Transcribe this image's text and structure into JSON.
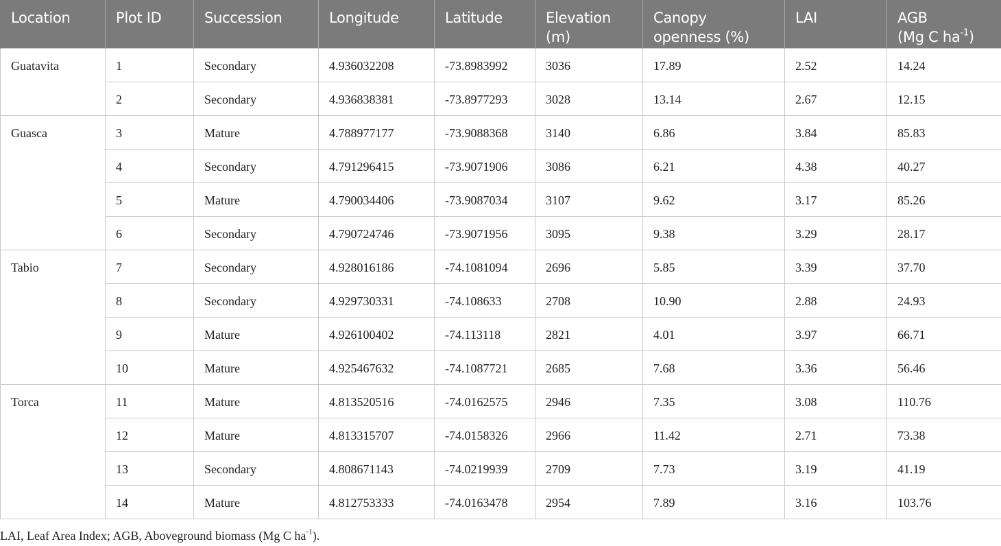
{
  "table": {
    "headers": [
      {
        "line1": "Location",
        "line2": ""
      },
      {
        "line1": "Plot ID",
        "line2": ""
      },
      {
        "line1": "Succession",
        "line2": ""
      },
      {
        "line1": "Longitude",
        "line2": ""
      },
      {
        "line1": "Latitude",
        "line2": ""
      },
      {
        "line1": "Elevation",
        "line2": "(m)"
      },
      {
        "line1": "Canopy",
        "line2": "openness (%)"
      },
      {
        "line1": "LAI",
        "line2": ""
      },
      {
        "line1": "AGB",
        "line2": "(Mg C ha",
        "sup": "-1",
        "after": ")"
      }
    ],
    "groups": [
      {
        "location": "Guatavita",
        "rows": [
          {
            "plot": "1",
            "succession": "Secondary",
            "longitude": "4.936032208",
            "latitude": "-73.8983992",
            "elevation": "3036",
            "canopy": "17.89",
            "lai": "2.52",
            "agb": "14.24"
          },
          {
            "plot": "2",
            "succession": "Secondary",
            "longitude": "4.936838381",
            "latitude": "-73.8977293",
            "elevation": "3028",
            "canopy": "13.14",
            "lai": "2.67",
            "agb": "12.15"
          }
        ]
      },
      {
        "location": "Guasca",
        "rows": [
          {
            "plot": "3",
            "succession": "Mature",
            "longitude": "4.788977177",
            "latitude": "-73.9088368",
            "elevation": "3140",
            "canopy": "6.86",
            "lai": "3.84",
            "agb": "85.83"
          },
          {
            "plot": "4",
            "succession": "Secondary",
            "longitude": "4.791296415",
            "latitude": "-73.9071906",
            "elevation": "3086",
            "canopy": "6.21",
            "lai": "4.38",
            "agb": "40.27"
          },
          {
            "plot": "5",
            "succession": "Mature",
            "longitude": "4.790034406",
            "latitude": "-73.9087034",
            "elevation": "3107",
            "canopy": "9.62",
            "lai": "3.17",
            "agb": "85.26"
          },
          {
            "plot": "6",
            "succession": "Secondary",
            "longitude": "4.790724746",
            "latitude": "-73.9071956",
            "elevation": "3095",
            "canopy": "9.38",
            "lai": "3.29",
            "agb": "28.17"
          }
        ]
      },
      {
        "location": "Tabio",
        "rows": [
          {
            "plot": "7",
            "succession": "Secondary",
            "longitude": "4.928016186",
            "latitude": "-74.1081094",
            "elevation": "2696",
            "canopy": "5.85",
            "lai": "3.39",
            "agb": "37.70"
          },
          {
            "plot": "8",
            "succession": "Secondary",
            "longitude": "4.929730331",
            "latitude": "-74.108633",
            "elevation": "2708",
            "canopy": "10.90",
            "lai": "2.88",
            "agb": "24.93"
          },
          {
            "plot": "9",
            "succession": "Mature",
            "longitude": "4.926100402",
            "latitude": "-74.113118",
            "elevation": "2821",
            "canopy": "4.01",
            "lai": "3.97",
            "agb": "66.71"
          },
          {
            "plot": "10",
            "succession": "Mature",
            "longitude": "4.925467632",
            "latitude": "-74.1087721",
            "elevation": "2685",
            "canopy": "7.68",
            "lai": "3.36",
            "agb": "56.46"
          }
        ]
      },
      {
        "location": "Torca",
        "rows": [
          {
            "plot": "11",
            "succession": "Mature",
            "longitude": "4.813520516",
            "latitude": "-74.0162575",
            "elevation": "2946",
            "canopy": "7.35",
            "lai": "3.08",
            "agb": "110.76"
          },
          {
            "plot": "12",
            "succession": "Mature",
            "longitude": "4.813315707",
            "latitude": "-74.0158326",
            "elevation": "2966",
            "canopy": "11.42",
            "lai": "2.71",
            "agb": "73.38"
          },
          {
            "plot": "13",
            "succession": "Secondary",
            "longitude": "4.808671143",
            "latitude": "-74.0219939",
            "elevation": "2709",
            "canopy": "7.73",
            "lai": "3.19",
            "agb": "41.19"
          },
          {
            "plot": "14",
            "succession": "Mature",
            "longitude": "4.812753333",
            "latitude": "-74.0163478",
            "elevation": "2954",
            "canopy": "7.89",
            "lai": "3.16",
            "agb": "103.76"
          }
        ]
      }
    ]
  },
  "footnote": {
    "text": "LAI, Leaf Area Index; AGB, Aboveground biomass (Mg C ha",
    "sup": "-1",
    "after": ")."
  },
  "colors": {
    "header_bg": "#7b7b7b",
    "header_text": "#ffffff",
    "grid": "#c9c9c9"
  }
}
